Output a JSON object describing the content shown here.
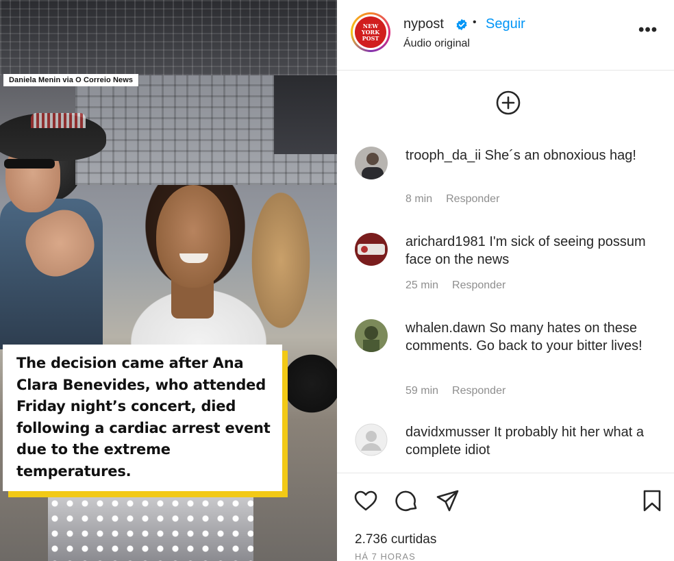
{
  "media": {
    "credit": "Daniela Menin via O Correio News",
    "caption": "The decision came after Ana Clara Benevides, who attended Friday night’s concert, died following a cardiac arrest event due to the extreme temperatures.",
    "caption_accent_color": "#f2c916"
  },
  "header": {
    "username": "nypost",
    "separator": "•",
    "follow_label": "Seguir",
    "audio_label": "Áudio original",
    "avatar_text": "NEW YORK POST",
    "more_label": "•••",
    "brand_color": "#d11e1e",
    "link_color": "#0095f6"
  },
  "comments": [
    {
      "username": "trooph_da_ii",
      "text": "She´s an obnoxious hag!",
      "time": "8 min",
      "reply": "Responder"
    },
    {
      "username": "arichard1981",
      "text": "I'm sick of seeing possum face on the news",
      "time": "25 min",
      "reply": "Responder"
    },
    {
      "username": "whalen.dawn",
      "text": "So many hates on these comments. Go back to your bitter lives!",
      "time": "59 min",
      "reply": "Responder"
    },
    {
      "username": "davidxmusser",
      "text": "It probably hit her what a complete idiot",
      "time": "",
      "reply": ""
    }
  ],
  "footer": {
    "likes": "2.736 curtidas",
    "posted": "HÁ 7 HORAS"
  },
  "icons": [
    "plus-circle-icon",
    "heart-icon",
    "comment-icon",
    "share-icon",
    "bookmark-icon",
    "more-icon",
    "verified-icon"
  ]
}
